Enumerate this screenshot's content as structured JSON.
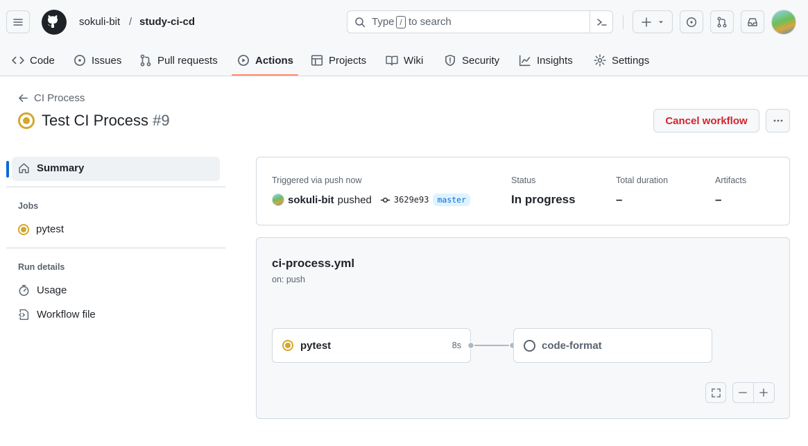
{
  "header": {
    "owner": "sokuli-bit",
    "separator": "/",
    "repo": "study-ci-cd",
    "search": {
      "prefix": "Type",
      "key": "/",
      "suffix": "to search"
    }
  },
  "nav": {
    "tabs": [
      {
        "label": "Code",
        "icon": "code-icon"
      },
      {
        "label": "Issues",
        "icon": "issue-icon"
      },
      {
        "label": "Pull requests",
        "icon": "pull-request-icon"
      },
      {
        "label": "Actions",
        "icon": "play-icon",
        "active": true
      },
      {
        "label": "Projects",
        "icon": "table-icon"
      },
      {
        "label": "Wiki",
        "icon": "book-icon"
      },
      {
        "label": "Security",
        "icon": "shield-icon"
      },
      {
        "label": "Insights",
        "icon": "graph-icon"
      },
      {
        "label": "Settings",
        "icon": "gear-icon"
      }
    ]
  },
  "run": {
    "back_label": "CI Process",
    "title": "Test CI Process",
    "number": "#9",
    "cancel_label": "Cancel workflow"
  },
  "sidebar": {
    "summary": "Summary",
    "jobs_heading": "Jobs",
    "jobs": [
      "pytest"
    ],
    "run_details_heading": "Run details",
    "details": [
      {
        "label": "Usage",
        "icon": "stopwatch-icon"
      },
      {
        "label": "Workflow file",
        "icon": "file-code-icon"
      }
    ]
  },
  "summary_card": {
    "trigger_label": "Triggered via push now",
    "user": "sokuli-bit",
    "action": "pushed",
    "commit": "3629e93",
    "branch": "master",
    "status_label": "Status",
    "status_value": "In progress",
    "duration_label": "Total duration",
    "duration_value": "–",
    "artifacts_label": "Artifacts",
    "artifacts_value": "–"
  },
  "graph": {
    "file": "ci-process.yml",
    "trigger": "on: push",
    "jobs": [
      {
        "name": "pytest",
        "time": "8s",
        "state": "in-progress"
      },
      {
        "name": "code-format",
        "time": "",
        "state": "queued"
      }
    ]
  },
  "colors": {
    "accent_underline": "#fd8c73",
    "in_progress": "#d4a72c",
    "danger": "#d1242f",
    "branch_bg": "#ddf4ff",
    "branch_fg": "#0969da"
  }
}
